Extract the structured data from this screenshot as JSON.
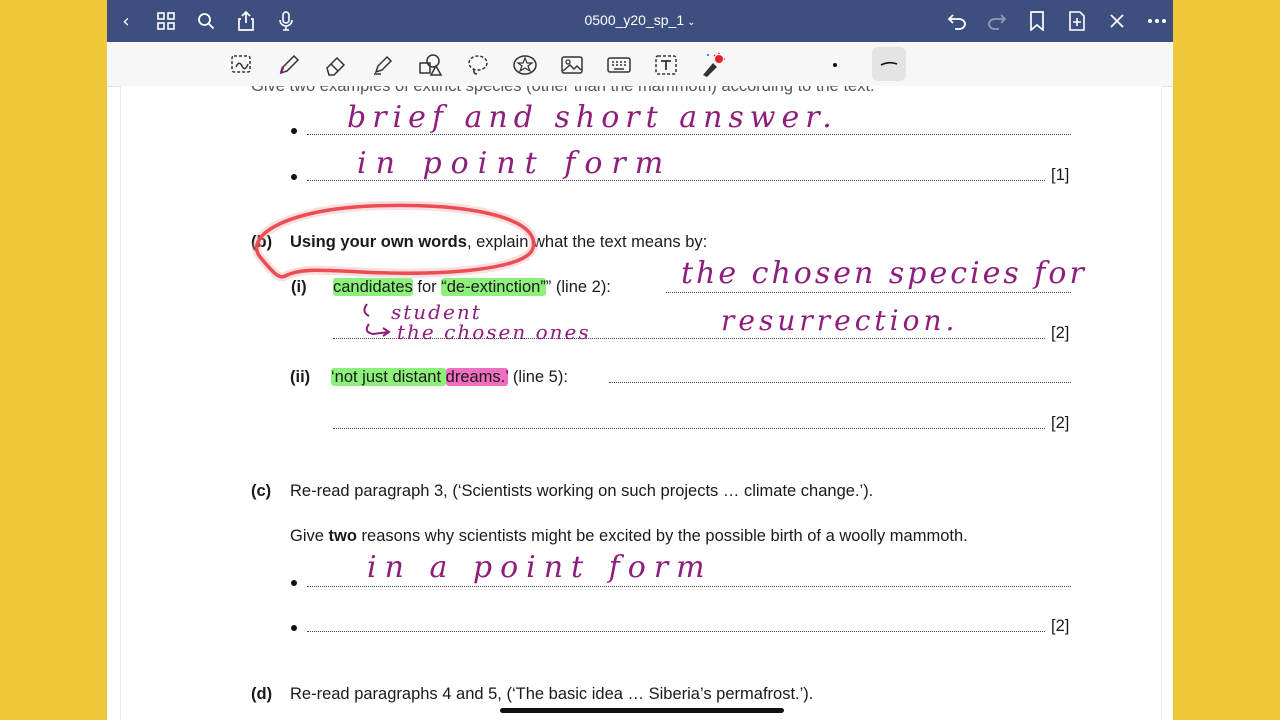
{
  "topbar": {
    "title": "0500_y20_sp_1",
    "title_chevron": "⌄",
    "icons": {
      "back": "‹",
      "grid": "⊞",
      "search": "⌕",
      "share": "⇪",
      "mic": "🎙",
      "undo": "↶",
      "redo": "↷",
      "bookmark": "⛉",
      "add_page": "⊕",
      "close": "✕",
      "more": "⋯"
    }
  },
  "question_a": {
    "prompt_partial": "Give two examples of extinct species (other than the mammoth) according to the text.",
    "marks": "[1]",
    "handwriting": [
      "brief and short answer.",
      "in point form"
    ]
  },
  "question_b": {
    "letter": "(b)",
    "prompt_bold": "Using your own words",
    "prompt_rest": ", explain what the text means by:",
    "part_i": {
      "label": "(i)",
      "quote_word1": "candidates",
      "quote_mid": " for ",
      "quote_word2": "“de-extinction”",
      "quote_end": "” (line 2):",
      "marks": "[2]",
      "handwriting_line1": "the chosen species for",
      "handwriting_line2": "resurrection.",
      "note_top": "student",
      "note_bottom": "the chosen ones"
    },
    "part_ii": {
      "label": "(ii)",
      "quote_green": "‘not just distant ",
      "quote_pink": "dreams.’",
      "quote_end": " (line 5):",
      "marks": "[2]"
    }
  },
  "question_c": {
    "letter": "(c)",
    "prompt": "Re-read paragraph 3, (‘Scientists working on such projects … climate change.’).",
    "sub_pre": "Give ",
    "sub_bold": "two",
    "sub_post": " reasons why scientists might be excited by the possible birth of a woolly mammoth.",
    "handwriting": "in a point form",
    "marks": "[2]"
  },
  "question_d": {
    "letter": "(d)",
    "prompt": "Re-read paragraphs 4 and 5, (‘The basic idea … Siberia’s permafrost.’)."
  },
  "colors": {
    "topbar": "#3d4f7e",
    "ink": "#8e1d7c",
    "circle": "#e8202a",
    "highlight_green": "#8df07a",
    "highlight_pink": "#f06ec0",
    "background": "#f0c93a"
  }
}
